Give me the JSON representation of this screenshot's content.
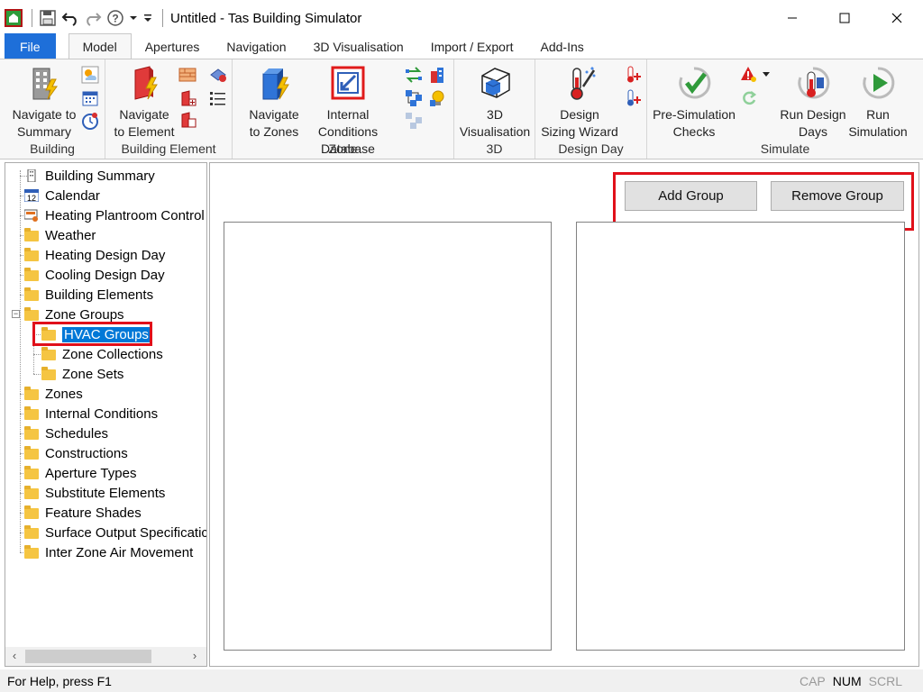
{
  "window": {
    "title": "Untitled - Tas Building Simulator",
    "minimize_label": "—",
    "maximize_label": "☐",
    "close_label": "✕"
  },
  "ribbon_tabs": [
    "File",
    "Model",
    "Apertures",
    "Navigation",
    "3D Visualisation",
    "Import / Export",
    "Add-Ins"
  ],
  "active_tab": "Model",
  "ribbon": {
    "building": {
      "label": "Building",
      "navigate_summary": [
        "Navigate to",
        "Summary"
      ]
    },
    "building_element": {
      "label": "Building Element",
      "navigate_element": [
        "Navigate",
        "to Element"
      ]
    },
    "zone": {
      "label": "Zone",
      "navigate_zones": [
        "Navigate",
        "to Zones"
      ],
      "internal_conditions": [
        "Internal Conditions",
        "Database"
      ]
    },
    "3d": {
      "label": "3D",
      "visualisation": [
        "3D",
        "Visualisation"
      ]
    },
    "design_day": {
      "label": "Design Day",
      "sizing_wizard": [
        "Design",
        "Sizing Wizard"
      ]
    },
    "simulate": {
      "label": "Simulate",
      "pre_sim": [
        "Pre-Simulation",
        "Checks"
      ],
      "run_design_days": [
        "Run Design",
        "Days"
      ],
      "run_simulation": [
        "Run",
        "Simulation"
      ]
    }
  },
  "tree": {
    "items": [
      {
        "label": "Building Summary",
        "icon": "building-icon"
      },
      {
        "label": "Calendar",
        "icon": "calendar-icon"
      },
      {
        "label": "Heating Plantroom Control",
        "icon": "plantroom-icon"
      },
      {
        "label": "Weather",
        "icon": "folder-icon"
      },
      {
        "label": "Heating Design Day",
        "icon": "folder-icon"
      },
      {
        "label": "Cooling Design Day",
        "icon": "folder-icon"
      },
      {
        "label": "Building Elements",
        "icon": "folder-icon"
      },
      {
        "label": "Zone Groups",
        "icon": "folder-icon"
      },
      {
        "label": "HVAC Groups",
        "icon": "folder-icon"
      },
      {
        "label": "Zone Collections",
        "icon": "folder-icon"
      },
      {
        "label": "Zone Sets",
        "icon": "folder-icon"
      },
      {
        "label": "Zones",
        "icon": "folder-icon"
      },
      {
        "label": "Internal Conditions",
        "icon": "folder-icon"
      },
      {
        "label": "Schedules",
        "icon": "folder-icon"
      },
      {
        "label": "Constructions",
        "icon": "folder-icon"
      },
      {
        "label": "Aperture Types",
        "icon": "folder-icon"
      },
      {
        "label": "Substitute Elements",
        "icon": "folder-icon"
      },
      {
        "label": "Feature Shades",
        "icon": "folder-icon"
      },
      {
        "label": "Surface Output Specificatic",
        "icon": "folder-icon"
      },
      {
        "label": "Inter Zone Air Movement",
        "icon": "folder-icon"
      }
    ],
    "selected": "HVAC Groups",
    "calendar_day": "12"
  },
  "main": {
    "add_group_label": "Add Group",
    "remove_group_label": "Remove Group"
  },
  "status": {
    "help_text": "For Help, press F1",
    "cap": "CAP",
    "num": "NUM",
    "scrl": "SCRL"
  },
  "colors": {
    "accent": "#1e6fd9",
    "highlight": "#e0101a",
    "selection": "#0078d7"
  }
}
